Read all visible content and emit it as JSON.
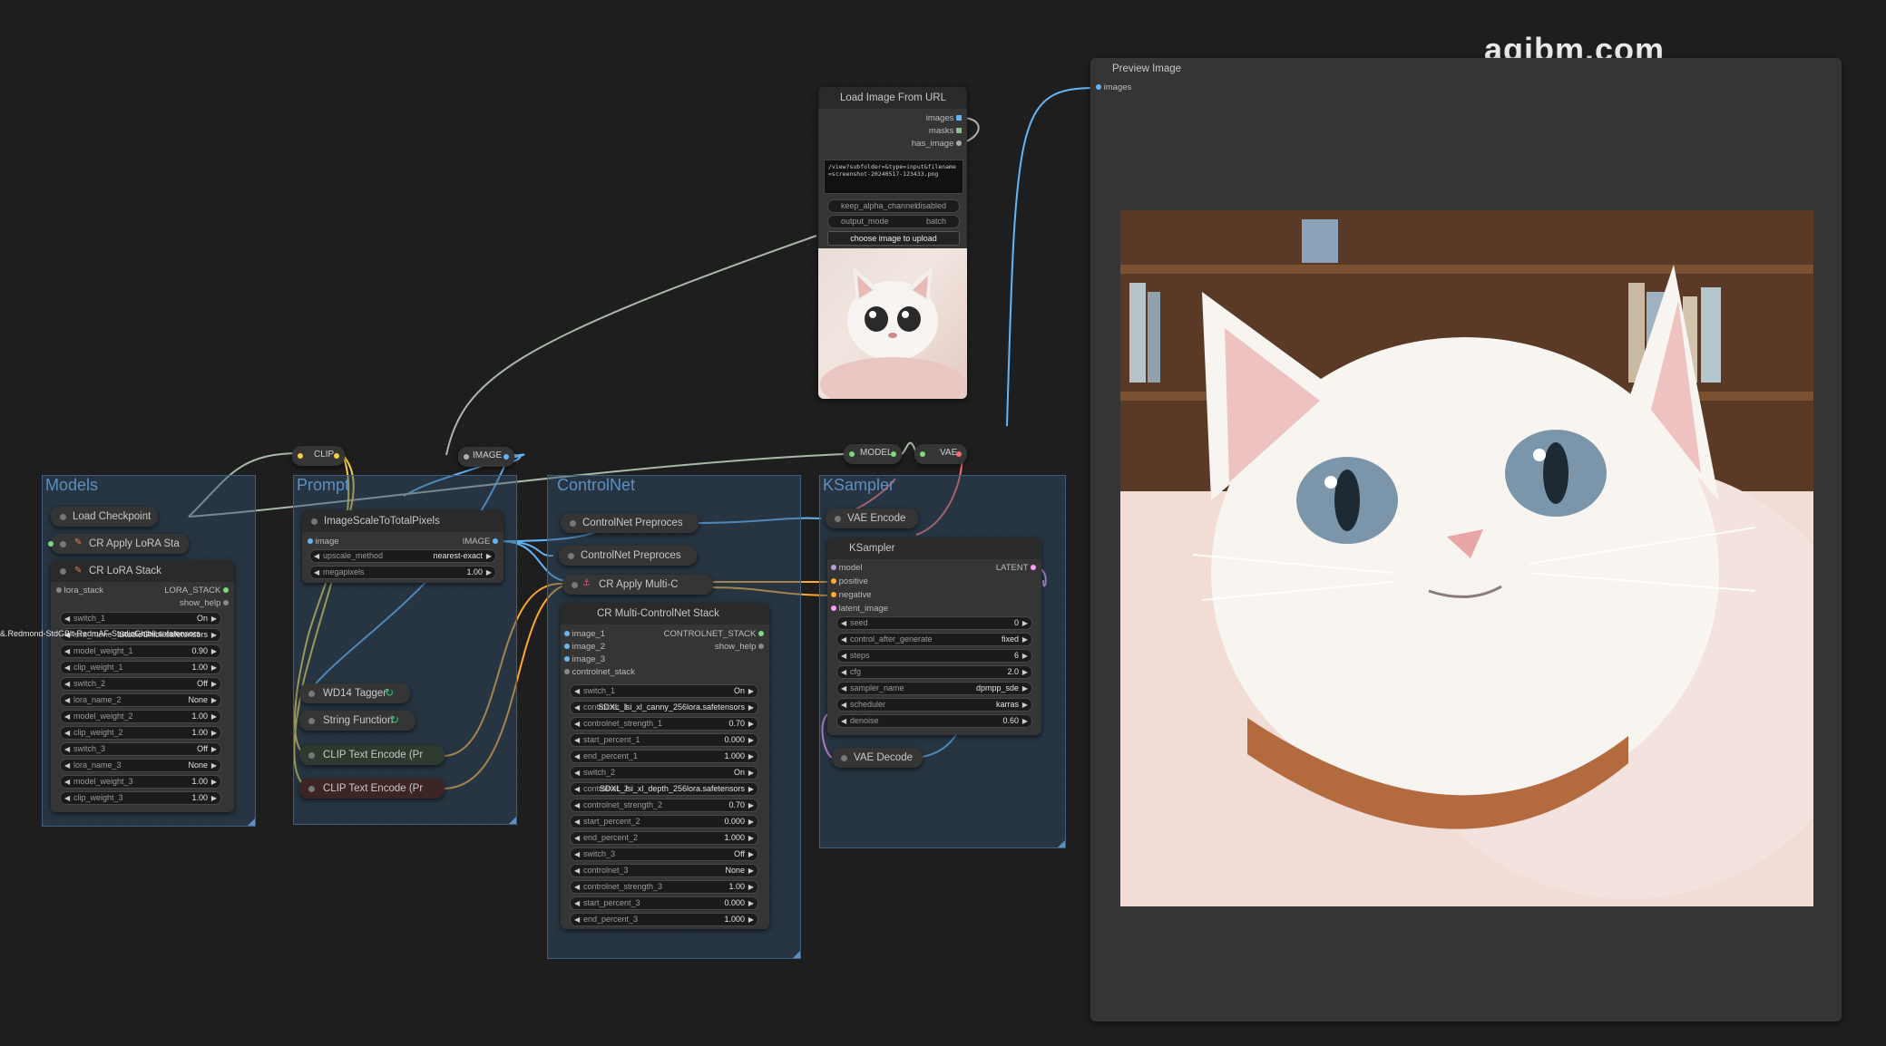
{
  "watermark": "agibm.com",
  "groups": {
    "models": "Models",
    "prompt": "Prompt",
    "controlnet": "ControlNet",
    "ksampler": "KSampler"
  },
  "reroutes": {
    "clip": "CLIP",
    "image": "IMAGE",
    "model": "MODEL",
    "vae": "VAE"
  },
  "load_checkpoint": {
    "title": "Load Checkpoint"
  },
  "cr_apply_lora": {
    "title": "CR Apply LoRA Sta"
  },
  "cr_lora_stack": {
    "title": "CR LoRA Stack",
    "input": "lora_stack",
    "output": "LORA_STACK",
    "show_help": "show_help",
    "overflow_text": "&.Redmond-StdGBlt-RedmAF-StudioGhibli.safetensors",
    "widgets": [
      {
        "label": "switch_1",
        "value": "On"
      },
      {
        "label": "lora_name_1",
        "value": "StudioGhibli.safetensors"
      },
      {
        "label": "model_weight_1",
        "value": "0.90"
      },
      {
        "label": "clip_weight_1",
        "value": "1.00"
      },
      {
        "label": "switch_2",
        "value": "Off"
      },
      {
        "label": "lora_name_2",
        "value": "None"
      },
      {
        "label": "model_weight_2",
        "value": "1.00"
      },
      {
        "label": "clip_weight_2",
        "value": "1.00"
      },
      {
        "label": "switch_3",
        "value": "Off"
      },
      {
        "label": "lora_name_3",
        "value": "None"
      },
      {
        "label": "model_weight_3",
        "value": "1.00"
      },
      {
        "label": "clip_weight_3",
        "value": "1.00"
      }
    ]
  },
  "image_scale": {
    "title": "ImageScaleToTotalPixels",
    "input": "image",
    "output": "IMAGE",
    "widgets": [
      {
        "label": "upscale_method",
        "value": "nearest-exact"
      },
      {
        "label": "megapixels",
        "value": "1.00"
      }
    ]
  },
  "wd14_tagger": {
    "title": "WD14 Tagger"
  },
  "string_function": {
    "title": "String Function"
  },
  "clip_encode_pos": {
    "title": "CLIP Text Encode (Pr"
  },
  "clip_encode_neg": {
    "title": "CLIP Text Encode (Pr"
  },
  "cn_preproc_1": {
    "title": "ControlNet Preproces"
  },
  "cn_preproc_2": {
    "title": "ControlNet Preproces"
  },
  "cr_apply_multi": {
    "title": "CR Apply Multi-C"
  },
  "cr_multi_cn_stack": {
    "title": "CR Multi-ControlNet Stack",
    "inputs": [
      "image_1",
      "image_2",
      "image_3",
      "controlnet_stack"
    ],
    "output": "CONTROLNET_STACK",
    "show_help": "show_help",
    "widgets": [
      {
        "label": "switch_1",
        "value": "On"
      },
      {
        "label": "controlnet_1",
        "value": "SDXL_lsi_xl_canny_256lora.safetensors"
      },
      {
        "label": "controlnet_strength_1",
        "value": "0.70"
      },
      {
        "label": "start_percent_1",
        "value": "0.000"
      },
      {
        "label": "end_percent_1",
        "value": "1.000"
      },
      {
        "label": "switch_2",
        "value": "On"
      },
      {
        "label": "controlnet_2",
        "value": "SDXL_lsi_xl_depth_256lora.safetensors"
      },
      {
        "label": "controlnet_strength_2",
        "value": "0.70"
      },
      {
        "label": "start_percent_2",
        "value": "0.000"
      },
      {
        "label": "end_percent_2",
        "value": "1.000"
      },
      {
        "label": "switch_3",
        "value": "Off"
      },
      {
        "label": "controlnet_3",
        "value": "None"
      },
      {
        "label": "controlnet_strength_3",
        "value": "1.00"
      },
      {
        "label": "start_percent_3",
        "value": "0.000"
      },
      {
        "label": "end_percent_3",
        "value": "1.000"
      }
    ]
  },
  "vae_encode": {
    "title": "VAE Encode"
  },
  "ksampler_node": {
    "title": "KSampler",
    "inputs": [
      "model",
      "positive",
      "negative",
      "latent_image"
    ],
    "output": "LATENT",
    "widgets": [
      {
        "label": "seed",
        "value": "0"
      },
      {
        "label": "control_after_generate",
        "value": "fixed"
      },
      {
        "label": "steps",
        "value": "6"
      },
      {
        "label": "cfg",
        "value": "2.0"
      },
      {
        "label": "sampler_name",
        "value": "dpmpp_sde"
      },
      {
        "label": "scheduler",
        "value": "karras"
      },
      {
        "label": "denoise",
        "value": "0.60"
      }
    ]
  },
  "vae_decode": {
    "title": "VAE Decode"
  },
  "load_image_url": {
    "title": "Load Image From URL",
    "outputs": [
      "images",
      "masks",
      "has_image"
    ],
    "url_text": "/view?subfolder=&type=input&filename=screenshot-20240517-123433.png",
    "widgets": [
      {
        "label": "keep_alpha_channel",
        "value": "disabled"
      },
      {
        "label": "output_mode",
        "value": "batch"
      }
    ],
    "upload_button": "choose image to upload"
  },
  "preview_image": {
    "title": "Preview Image",
    "input": "images"
  },
  "colors": {
    "clip_wire": "#f5d142",
    "image_wire": "#64b5f6",
    "model_wire": "#b0c0b0",
    "vae_wire": "#ff6e6e",
    "conditioning_wire": "#ffa931",
    "latent_wire": "#ff9cf9",
    "group_fill": "#34526e"
  }
}
